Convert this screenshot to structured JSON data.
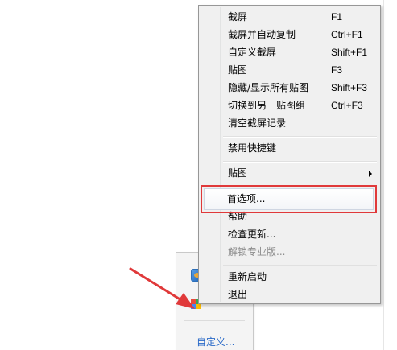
{
  "tray": {
    "link_label": "自定义..."
  },
  "menu": {
    "items": [
      {
        "label": "截屏",
        "shortcut": "F1"
      },
      {
        "label": "截屏并自动复制",
        "shortcut": "Ctrl+F1"
      },
      {
        "label": "自定义截屏",
        "shortcut": "Shift+F1"
      },
      {
        "label": "贴图",
        "shortcut": "F3"
      },
      {
        "label": "隐藏/显示所有贴图",
        "shortcut": "Shift+F3"
      },
      {
        "label": "切换到另一贴图组",
        "shortcut": "Ctrl+F3"
      },
      {
        "label": "清空截屏记录",
        "shortcut": ""
      },
      {
        "label": "禁用快捷键",
        "shortcut": ""
      },
      {
        "label": "贴图",
        "shortcut": "",
        "has_submenu": true
      },
      {
        "label": "首选项...",
        "shortcut": "",
        "highlighted": true
      },
      {
        "label": "帮助",
        "shortcut": ""
      },
      {
        "label": "检查更新...",
        "shortcut": ""
      },
      {
        "label": "解锁专业版...",
        "shortcut": "",
        "disabled": true
      },
      {
        "label": "重新启动",
        "shortcut": ""
      },
      {
        "label": "退出",
        "shortcut": ""
      }
    ]
  },
  "colors": {
    "highlight_border": "#e0393a",
    "arrow": "#e0393a",
    "link": "#2a6ac8"
  }
}
